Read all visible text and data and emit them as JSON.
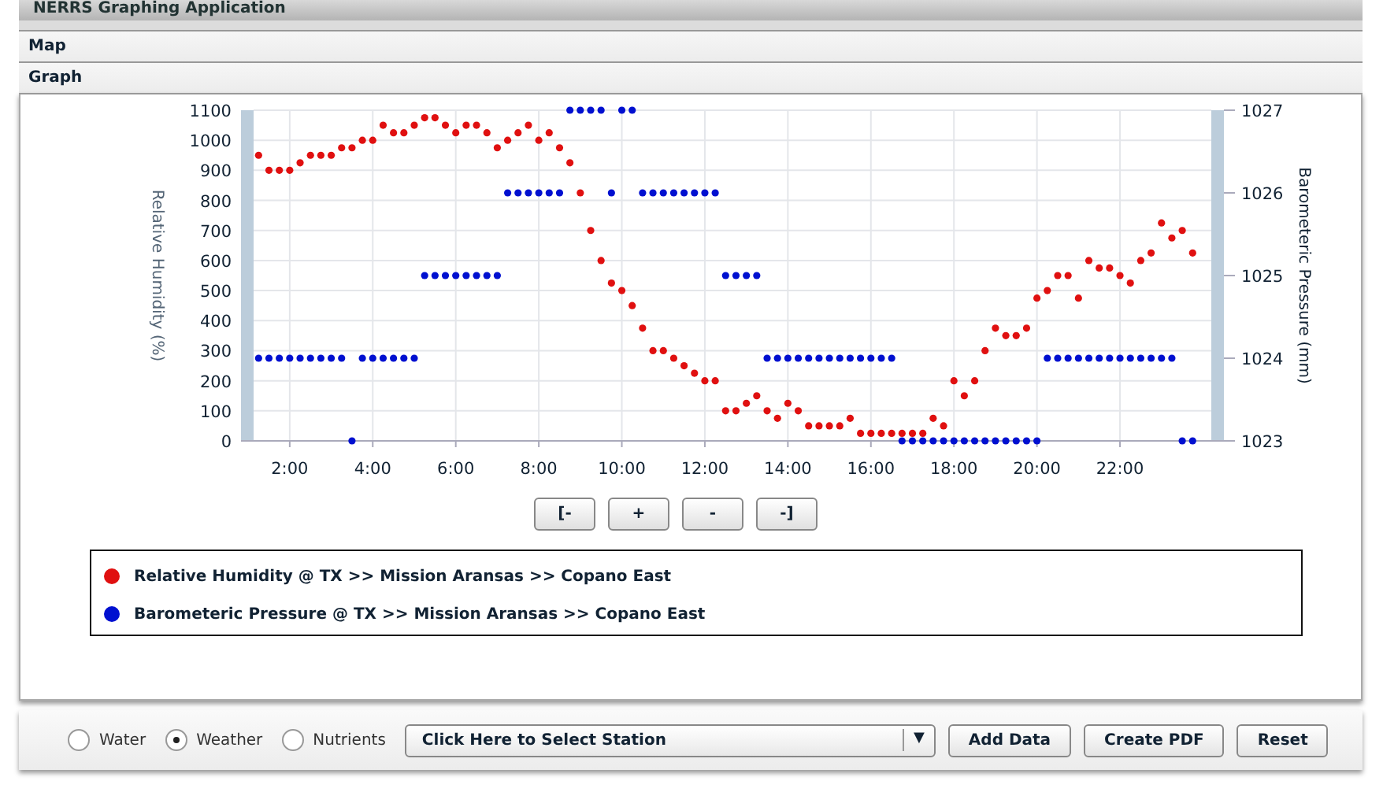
{
  "app_title": "NERRS Graphing Application",
  "sections": [
    {
      "label": "Map"
    },
    {
      "label": "Graph"
    }
  ],
  "graph": {
    "chart_data": {
      "type": "scatter",
      "ylabel": "Relative Humidity (%)",
      "y2label": "Barometeric Pressure (mm)",
      "x": [
        1.25,
        1.5,
        1.75,
        2,
        2.25,
        2.5,
        2.75,
        3,
        3.25,
        3.5,
        3.75,
        4,
        4.25,
        4.5,
        4.75,
        5,
        5.25,
        5.5,
        5.75,
        6,
        6.25,
        6.5,
        6.75,
        7,
        7.25,
        7.5,
        7.75,
        8,
        8.25,
        8.5,
        8.75,
        9,
        9.25,
        9.5,
        9.75,
        10,
        10.25,
        10.5,
        10.75,
        11,
        11.25,
        11.5,
        11.75,
        12,
        12.25,
        12.5,
        12.75,
        13,
        13.25,
        13.5,
        13.75,
        14,
        14.25,
        14.5,
        14.75,
        15,
        15.25,
        15.5,
        15.75,
        16,
        16.25,
        16.5,
        16.75,
        17,
        17.25,
        17.5,
        17.75,
        18,
        18.25,
        18.5,
        18.75,
        19,
        19.25,
        19.5,
        19.75,
        20,
        20.25,
        20.5,
        20.75,
        21,
        21.25,
        21.5,
        21.75,
        22,
        22.25,
        22.5,
        22.75,
        23,
        23.25,
        23.5,
        23.75
      ],
      "grid": true,
      "xlim": [
        1.13,
        24.2
      ],
      "ylim": [
        0,
        1100
      ],
      "y2lim": [
        1023,
        1027
      ],
      "xticks": [
        {
          "value": 2,
          "label": "2:00"
        },
        {
          "value": 4,
          "label": "4:00"
        },
        {
          "value": 6,
          "label": "6:00"
        },
        {
          "value": 8,
          "label": "8:00"
        },
        {
          "value": 10,
          "label": "10:00"
        },
        {
          "value": 12,
          "label": "12:00"
        },
        {
          "value": 14,
          "label": "14:00"
        },
        {
          "value": 16,
          "label": "16:00"
        },
        {
          "value": 18,
          "label": "18:00"
        },
        {
          "value": 20,
          "label": "20:00"
        },
        {
          "value": 22,
          "label": "22:00"
        }
      ],
      "yticks": [
        0,
        100,
        200,
        300,
        400,
        500,
        600,
        700,
        800,
        900,
        1000,
        1100
      ],
      "y2ticks": [
        1023,
        1024,
        1025,
        1026,
        1027
      ],
      "series": [
        {
          "color": "#e01010",
          "axis": "y",
          "values": [
            950,
            900,
            900,
            900,
            925,
            950,
            950,
            950,
            975,
            975,
            1000,
            1000,
            1050,
            1025,
            1025,
            1050,
            1075,
            1075,
            1050,
            1025,
            1050,
            1050,
            1025,
            975,
            1000,
            1025,
            1050,
            1000,
            1025,
            975,
            925,
            825,
            700,
            600,
            525,
            500,
            450,
            375,
            300,
            300,
            275,
            250,
            225,
            200,
            200,
            100,
            100,
            125,
            150,
            100,
            75,
            125,
            100,
            50,
            50,
            50,
            50,
            75,
            25,
            25,
            25,
            25,
            25,
            25,
            25,
            75,
            50,
            200,
            150,
            200,
            300,
            375,
            350,
            350,
            375,
            475,
            500,
            550,
            550,
            475,
            600,
            575,
            575,
            550,
            525,
            600,
            625,
            725,
            675,
            700,
            625
          ]
        },
        {
          "color": "#0010d0",
          "axis": "y2",
          "values": [
            1024,
            1024,
            1024,
            1024,
            1024,
            1024,
            1024,
            1024,
            1024,
            1023,
            1024,
            1024,
            1024,
            1024,
            1024,
            1024,
            1025,
            1025,
            1025,
            1025,
            1025,
            1025,
            1025,
            1025,
            1026,
            1026,
            1026,
            1026,
            1026,
            1026,
            1027,
            1027,
            1027,
            1027,
            1026,
            1027,
            1027,
            1026,
            1026,
            1026,
            1026,
            1026,
            1026,
            1026,
            1026,
            1025,
            1025,
            1025,
            1025,
            1024,
            1024,
            1024,
            1024,
            1024,
            1024,
            1024,
            1024,
            1024,
            1024,
            1024,
            1024,
            1024,
            1023,
            1023,
            1023,
            1023,
            1023,
            1023,
            1023,
            1023,
            1023,
            1023,
            1023,
            1023,
            1023,
            1023,
            1024,
            1024,
            1024,
            1024,
            1024,
            1024,
            1024,
            1024,
            1024,
            1024,
            1024,
            1024,
            1024,
            1023,
            1023
          ]
        }
      ]
    },
    "zoom_buttons": [
      {
        "label": "[-"
      },
      {
        "label": "+"
      },
      {
        "label": "-"
      },
      {
        "label": "-]"
      }
    ],
    "legend": [
      {
        "label": "Relative Humidity @ TX >> Mission Aransas >> Copano East",
        "color": "#e01010"
      },
      {
        "label": "Barometeric Pressure @ TX >> Mission Aransas >> Copano East",
        "color": "#0010d0"
      }
    ]
  },
  "toolbar": {
    "radios": [
      {
        "label": "Water",
        "selected": false
      },
      {
        "label": "Weather",
        "selected": true
      },
      {
        "label": "Nutrients",
        "selected": false
      }
    ],
    "station_select": {
      "value": "Click Here to Select Station",
      "caret": "▼"
    },
    "buttons": [
      {
        "label": "Add Data"
      },
      {
        "label": "Create PDF"
      },
      {
        "label": "Reset"
      }
    ]
  }
}
